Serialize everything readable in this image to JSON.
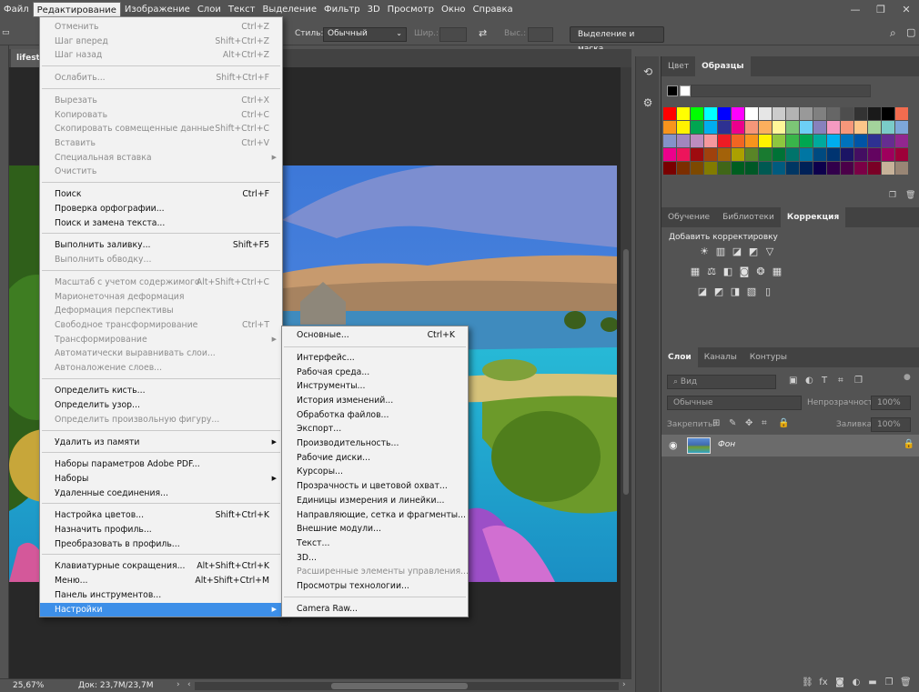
{
  "menubar": {
    "items": [
      "Файл",
      "Редактирование",
      "Изображение",
      "Слои",
      "Текст",
      "Выделение",
      "Фильтр",
      "3D",
      "Просмотр",
      "Окно",
      "Справка"
    ],
    "active_index": 1
  },
  "window_controls": {
    "minimize": "—",
    "maximize": "❐",
    "close": "✕"
  },
  "options_bar": {
    "style_label": "Стиль:",
    "style_value": "Обычный",
    "width_label": "Шир.:",
    "height_label": "Выс.:",
    "select_mask_button": "Выделение и маска..."
  },
  "document": {
    "tab_title": "lifestyle"
  },
  "status": {
    "zoom": "25,67%",
    "doc": "Док: 23,7M/23,7M"
  },
  "panels": {
    "color_tabs": [
      "Цвет",
      "Образцы"
    ],
    "swatch_colors": [
      "#ff0000",
      "#ffff00",
      "#00ff00",
      "#00ffff",
      "#0000ff",
      "#ff00ff",
      "#ffffff",
      "#e6e6e6",
      "#cccccc",
      "#b3b3b3",
      "#999999",
      "#808080",
      "#666666",
      "#4d4d4d",
      "#333333",
      "#1a1a1a",
      "#000000",
      "#f26c4f",
      "#f7941d",
      "#fff200",
      "#00a651",
      "#00aeef",
      "#2e3192",
      "#ec008c",
      "#f69679",
      "#fbaf5d",
      "#fff799",
      "#7cc576",
      "#6dcff6",
      "#8781bd",
      "#f49ac1",
      "#f7977a",
      "#fdc689",
      "#a3d39c",
      "#7accc8",
      "#7da7d9",
      "#8493ca",
      "#a186be",
      "#bd8cbf",
      "#f5989d",
      "#ed1c24",
      "#f26522",
      "#f7941d",
      "#fff200",
      "#8dc63f",
      "#39b54a",
      "#00a651",
      "#00a99d",
      "#00aeef",
      "#0072bc",
      "#0054a6",
      "#2e3192",
      "#662d91",
      "#92278f",
      "#ec008c",
      "#ed145b",
      "#9e0b0f",
      "#a0410d",
      "#a36209",
      "#aba000",
      "#598527",
      "#197b30",
      "#007236",
      "#00746b",
      "#0076a3",
      "#004a80",
      "#003471",
      "#1b1464",
      "#440e62",
      "#630460",
      "#9e005d",
      "#9e0039",
      "#790000",
      "#7b2e00",
      "#7d4900",
      "#827b00",
      "#406618",
      "#005e20",
      "#005826",
      "#005952",
      "#005b7f",
      "#003663",
      "#002157",
      "#0d004c",
      "#32004b",
      "#4b0049",
      "#7b0046",
      "#7a0026",
      "#c7b299",
      "#998675"
    ],
    "adjust_tabs": [
      "Обучение",
      "Библиотеки",
      "Коррекция"
    ],
    "adjust_title": "Добавить корректировку",
    "layers_tabs": [
      "Слои",
      "Каналы",
      "Контуры"
    ],
    "layers_search": "Вид",
    "blend_mode": "Обычные",
    "opacity_label": "Непрозрачность:",
    "opacity_value": "100%",
    "lock_label": "Закрепить:",
    "fill_label": "Заливка:",
    "fill_value": "100%",
    "layer_name": "Фон"
  },
  "edit_menu": {
    "items": [
      {
        "label": "Отменить",
        "shortcut": "Ctrl+Z",
        "disabled": true
      },
      {
        "label": "Шаг вперед",
        "shortcut": "Shift+Ctrl+Z",
        "disabled": true
      },
      {
        "label": "Шаг назад",
        "shortcut": "Alt+Ctrl+Z",
        "disabled": true
      },
      {
        "label": "Ослабить...",
        "shortcut": "Shift+Ctrl+F",
        "disabled": true
      },
      {
        "label": "Вырезать",
        "shortcut": "Ctrl+X",
        "disabled": true
      },
      {
        "label": "Копировать",
        "shortcut": "Ctrl+C",
        "disabled": true
      },
      {
        "label": "Скопировать совмещенные данные",
        "shortcut": "Shift+Ctrl+C",
        "disabled": true
      },
      {
        "label": "Вставить",
        "shortcut": "Ctrl+V",
        "disabled": true
      },
      {
        "label": "Специальная вставка",
        "shortcut": "",
        "disabled": true
      },
      {
        "label": "Очистить",
        "shortcut": "",
        "disabled": true
      },
      {
        "label": "Поиск",
        "shortcut": "Ctrl+F",
        "disabled": false
      },
      {
        "label": "Проверка орфографии...",
        "shortcut": "",
        "disabled": false
      },
      {
        "label": "Поиск и замена текста...",
        "shortcut": "",
        "disabled": false
      },
      {
        "label": "Выполнить заливку...",
        "shortcut": "Shift+F5",
        "disabled": false
      },
      {
        "label": "Выполнить обводку...",
        "shortcut": "",
        "disabled": true
      },
      {
        "label": "Масштаб с учетом содержимого",
        "shortcut": "Alt+Shift+Ctrl+C",
        "disabled": true
      },
      {
        "label": "Марионеточная деформация",
        "shortcut": "",
        "disabled": true
      },
      {
        "label": "Деформация перспективы",
        "shortcut": "",
        "disabled": true
      },
      {
        "label": "Свободное трансформирование",
        "shortcut": "Ctrl+T",
        "disabled": true
      },
      {
        "label": "Трансформирование",
        "shortcut": "",
        "disabled": true
      },
      {
        "label": "Автоматически выравнивать слои...",
        "shortcut": "",
        "disabled": true
      },
      {
        "label": "Автоналожение слоев...",
        "shortcut": "",
        "disabled": true
      },
      {
        "label": "Определить кисть...",
        "shortcut": "",
        "disabled": false
      },
      {
        "label": "Определить узор...",
        "shortcut": "",
        "disabled": false
      },
      {
        "label": "Определить произвольную фигуру...",
        "shortcut": "",
        "disabled": true
      },
      {
        "label": "Удалить из памяти",
        "shortcut": "",
        "disabled": false
      },
      {
        "label": "Наборы параметров Adobe PDF...",
        "shortcut": "",
        "disabled": false
      },
      {
        "label": "Наборы",
        "shortcut": "",
        "disabled": false
      },
      {
        "label": "Удаленные соединения...",
        "shortcut": "",
        "disabled": false
      },
      {
        "label": "Настройка цветов...",
        "shortcut": "Shift+Ctrl+K",
        "disabled": false
      },
      {
        "label": "Назначить профиль...",
        "shortcut": "",
        "disabled": false
      },
      {
        "label": "Преобразовать в профиль...",
        "shortcut": "",
        "disabled": false
      },
      {
        "label": "Клавиатурные сокращения...",
        "shortcut": "Alt+Shift+Ctrl+K",
        "disabled": false
      },
      {
        "label": "Меню...",
        "shortcut": "Alt+Shift+Ctrl+M",
        "disabled": false
      },
      {
        "label": "Панель инструментов...",
        "shortcut": "",
        "disabled": false
      },
      {
        "label": "Настройки",
        "shortcut": "",
        "disabled": false
      }
    ]
  },
  "settings_submenu": {
    "items": [
      {
        "label": "Основные...",
        "shortcut": "Ctrl+K",
        "disabled": false
      },
      {
        "label": "Интерфейс...",
        "shortcut": "",
        "disabled": false
      },
      {
        "label": "Рабочая среда...",
        "shortcut": "",
        "disabled": false
      },
      {
        "label": "Инструменты...",
        "shortcut": "",
        "disabled": false
      },
      {
        "label": "История изменений...",
        "shortcut": "",
        "disabled": false
      },
      {
        "label": "Обработка файлов...",
        "shortcut": "",
        "disabled": false
      },
      {
        "label": "Экспорт...",
        "shortcut": "",
        "disabled": false
      },
      {
        "label": "Производительность...",
        "shortcut": "",
        "disabled": false
      },
      {
        "label": "Рабочие диски...",
        "shortcut": "",
        "disabled": false
      },
      {
        "label": "Курсоры...",
        "shortcut": "",
        "disabled": false
      },
      {
        "label": "Прозрачность и цветовой охват...",
        "shortcut": "",
        "disabled": false
      },
      {
        "label": "Единицы измерения и линейки...",
        "shortcut": "",
        "disabled": false
      },
      {
        "label": "Направляющие, сетка и фрагменты...",
        "shortcut": "",
        "disabled": false
      },
      {
        "label": "Внешние модули...",
        "shortcut": "",
        "disabled": false
      },
      {
        "label": "Текст...",
        "shortcut": "",
        "disabled": false
      },
      {
        "label": "3D...",
        "shortcut": "",
        "disabled": false
      },
      {
        "label": "Расширенные элементы управления...",
        "shortcut": "",
        "disabled": true
      },
      {
        "label": "Просмотры технологии...",
        "shortcut": "",
        "disabled": false
      },
      {
        "label": "Camera Raw...",
        "shortcut": "",
        "disabled": false
      }
    ]
  }
}
